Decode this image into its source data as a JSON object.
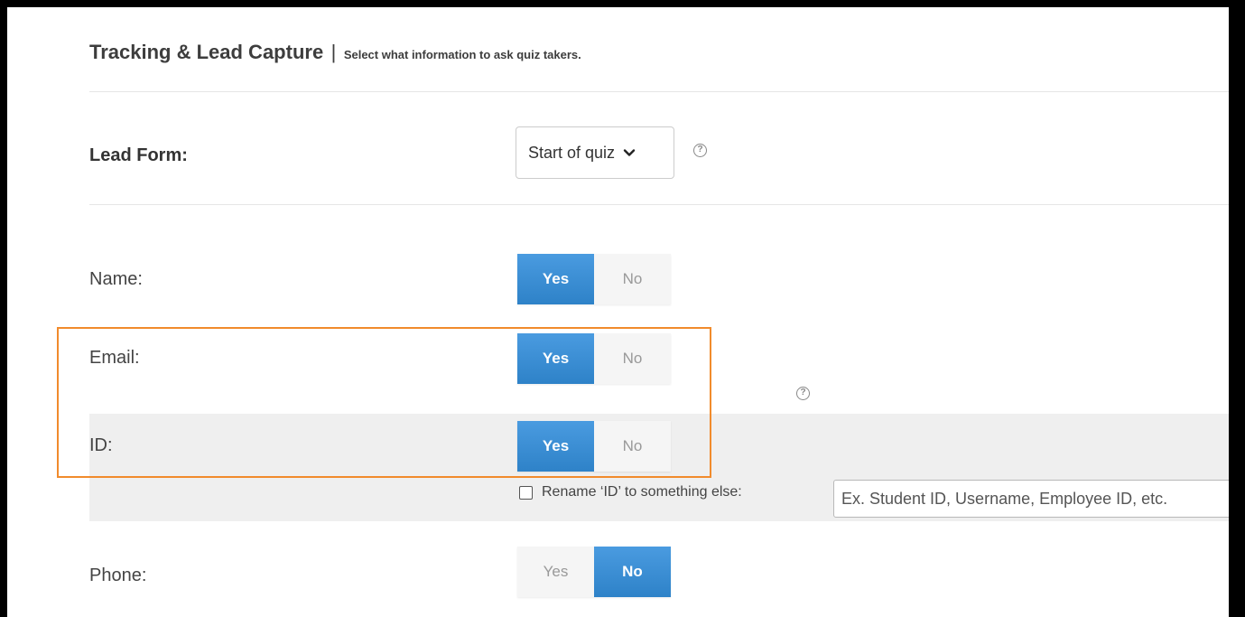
{
  "header": {
    "title": "Tracking & Lead Capture",
    "separator": "|",
    "subtitle": "Select what information to ask quiz takers."
  },
  "lead_form": {
    "label": "Lead Form:",
    "selected": "Start of quiz",
    "options": [
      "Start of quiz"
    ]
  },
  "fields": {
    "name": {
      "label": "Name:",
      "yes": "Yes",
      "no": "No",
      "value": "Yes"
    },
    "email": {
      "label": "Email:",
      "yes": "Yes",
      "no": "No",
      "value": "Yes"
    },
    "id": {
      "label": "ID:",
      "yes": "Yes",
      "no": "No",
      "value": "Yes"
    },
    "phone": {
      "label": "Phone:",
      "yes": "Yes",
      "no": "No",
      "value": "No"
    }
  },
  "rename_id": {
    "checkbox_label": "Rename ‘ID’ to something else:",
    "checked": false,
    "placeholder": "Ex. Student ID, Username, Employee ID, etc."
  },
  "help_icon_glyph": "?",
  "colors": {
    "accent": "#3a8fd3",
    "highlight": "#f18b2c",
    "band": "#efefef"
  }
}
